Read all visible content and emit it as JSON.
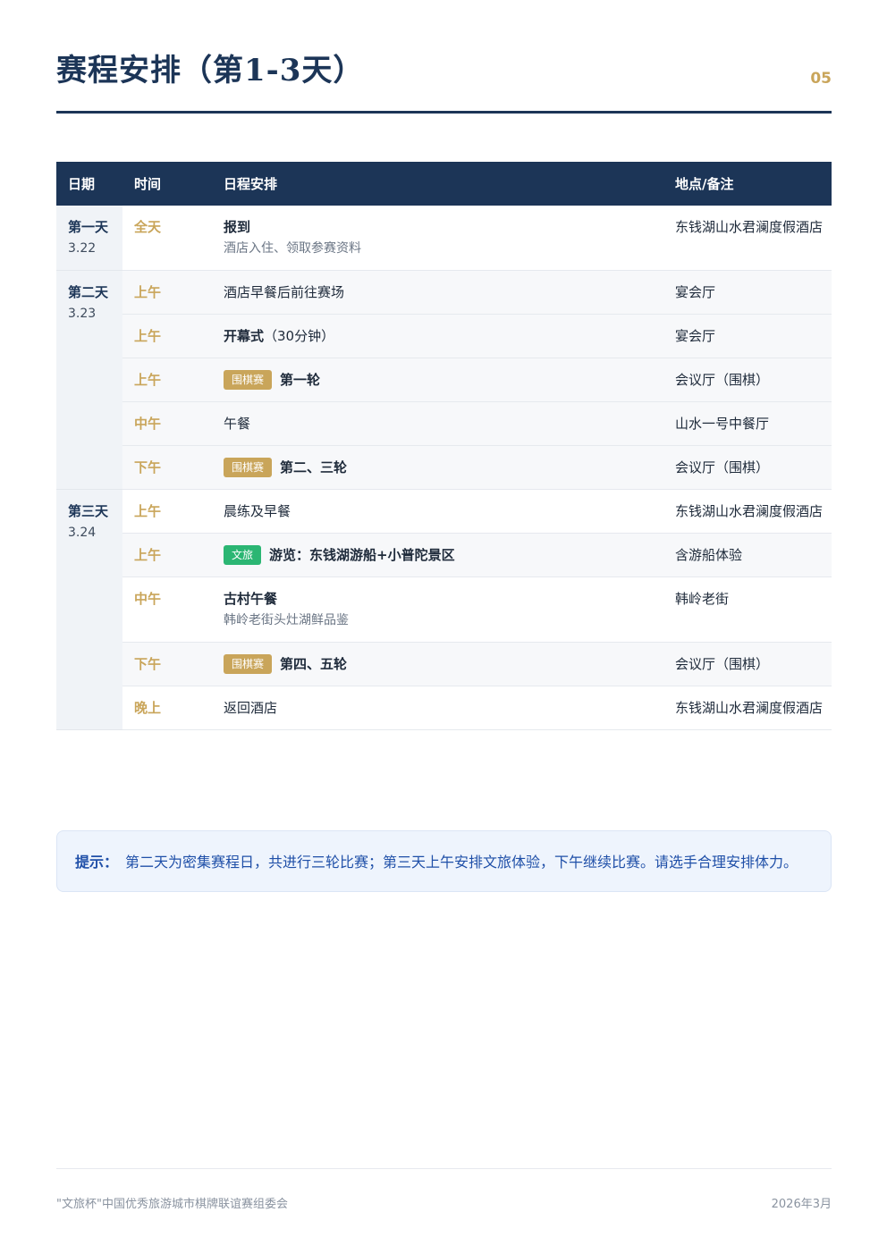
{
  "header": {
    "title": "赛程安排（第1-3天）",
    "page_number": "05"
  },
  "table": {
    "columns": [
      "日期",
      "时间",
      "日程安排",
      "地点/备注"
    ],
    "days": [
      {
        "name": "第一天",
        "date": "3.22",
        "rows": [
          {
            "time": "全天",
            "event": "报到",
            "sub": "酒店入住、领取参赛资料",
            "location": "东钱湖山水君澜度假酒店"
          }
        ]
      },
      {
        "name": "第二天",
        "date": "3.23",
        "rows": [
          {
            "time": "上午",
            "event": "酒店早餐后前往赛场",
            "location": "宴会厅"
          },
          {
            "time": "上午",
            "event": "开幕式",
            "event_extra": "（30分钟）",
            "location": "宴会厅"
          },
          {
            "time": "上午",
            "tag": "围棋赛",
            "event": "第一轮",
            "location": "会议厅（围棋）"
          },
          {
            "time": "中午",
            "event": "午餐",
            "location": "山水一号中餐厅"
          },
          {
            "time": "下午",
            "tag": "围棋赛",
            "event": "第二、三轮",
            "location": "会议厅（围棋）"
          }
        ]
      },
      {
        "name": "第三天",
        "date": "3.24",
        "rows": [
          {
            "time": "上午",
            "event": "晨练及早餐",
            "location": "东钱湖山水君澜度假酒店"
          },
          {
            "time": "上午",
            "tag": "文旅",
            "event": "游览：东钱湖游船+小普陀景区",
            "location": "含游船体验"
          },
          {
            "time": "中午",
            "event": "古村午餐",
            "sub": "韩岭老街头灶湖鲜品鉴",
            "location": "韩岭老街"
          },
          {
            "time": "下午",
            "tag": "围棋赛",
            "event": "第四、五轮",
            "location": "会议厅（围棋）"
          },
          {
            "time": "晚上",
            "event": "返回酒店",
            "location": "东钱湖山水君澜度假酒店"
          }
        ]
      }
    ]
  },
  "tip": {
    "label": "提示：",
    "text": "第二天为密集赛程日，共进行三轮比赛；第三天上午安排文旅体验，下午继续比赛。请选手合理安排体力。"
  },
  "footer": {
    "organizer": "\"文旅杯\"中国优秀旅游城市棋牌联谊赛组委会",
    "date": "2026年3月"
  },
  "colors": {
    "navy": "#1c3557",
    "gold": "#c9a55a",
    "green_tag": "#2bb673",
    "tip_text": "#1f4fa8"
  }
}
